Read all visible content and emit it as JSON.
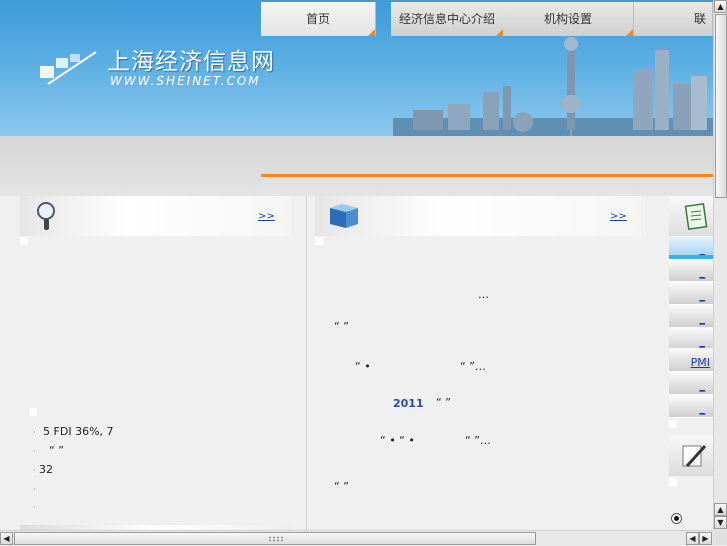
{
  "header": {
    "logo_cn": "上海经济信息网",
    "logo_en": "WWW.SHEINET.COM"
  },
  "nav": {
    "tabs": [
      {
        "label": "首页",
        "active": true
      },
      {
        "label": "经济信息中心介绍",
        "active": false
      },
      {
        "label": "机构设置",
        "active": false
      },
      {
        "label": "联系",
        "active": false
      }
    ]
  },
  "left_panel": {
    "icon": "magnifier-icon",
    "more": ">>",
    "news": [
      {
        "bullet": "·",
        "text": "5 FDI 36%,      7"
      },
      {
        "bullet": "·",
        "text": "“      ”"
      },
      {
        "bullet": "·",
        "text": "          32"
      },
      {
        "bullet": "·",
        "text": ""
      },
      {
        "bullet": "·",
        "text": ""
      }
    ]
  },
  "middle_panel": {
    "icon": "book-icon",
    "more": ">>",
    "lines": {
      "l1": "…",
      "l2": "“      ”",
      "l3a": "“  •",
      "l3b": "“   ”…",
      "l4_year": "2011",
      "l4b": "“   ”",
      "l5a": "“ •   “ •",
      "l5b": "“   ”…",
      "l6": "“      ”"
    }
  },
  "right_sidebar": {
    "icon": "notepad-icon",
    "items": [
      "_",
      "_",
      "_",
      "_",
      "_",
      "PMI",
      "_",
      "_"
    ],
    "pen_icon": "pen-icon"
  },
  "scrollbars": {
    "up": "▲",
    "down": "▼",
    "left": "◀",
    "right": "▶"
  },
  "colors": {
    "accent_orange": "#f08a1e",
    "link_blue": "#1a3aa8",
    "banner_blue": "#3f9ad8"
  }
}
